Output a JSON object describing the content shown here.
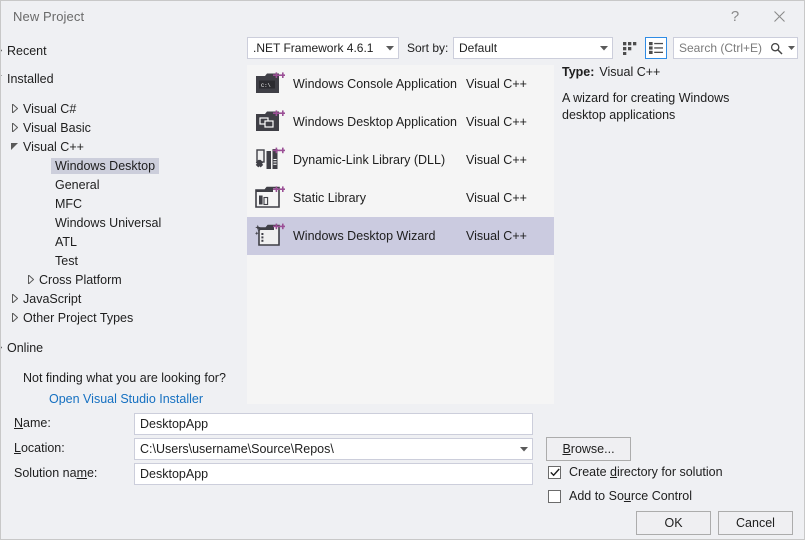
{
  "window": {
    "title": "New Project",
    "help_icon": "question-mark-icon",
    "close_icon": "close-icon"
  },
  "toolbar": {
    "framework_value": ".NET Framework 4.6.1",
    "sort_by_label": "Sort by:",
    "sort_by_value": "Default",
    "view_tiles_icon": "tiles-view-icon",
    "view_list_icon": "list-view-icon",
    "search_placeholder": "Search (Ctrl+E)",
    "search_value": "",
    "search_icon": "magnifier-icon",
    "accent_selected": "#2f8ce5"
  },
  "sidebar": {
    "items": [
      {
        "label": "Recent",
        "level": 0,
        "arrow": "collapsed",
        "selected": false
      },
      {
        "label": "Installed",
        "level": 0,
        "arrow": "expanded",
        "selected": false
      },
      {
        "label": "Visual C#",
        "level": 1,
        "arrow": "collapsed",
        "selected": false
      },
      {
        "label": "Visual Basic",
        "level": 1,
        "arrow": "collapsed",
        "selected": false
      },
      {
        "label": "Visual C++",
        "level": 1,
        "arrow": "expanded",
        "selected": false
      },
      {
        "label": "Windows Desktop",
        "level": 2,
        "arrow": "none",
        "selected": true
      },
      {
        "label": "General",
        "level": 2,
        "arrow": "none",
        "selected": false
      },
      {
        "label": "MFC",
        "level": 2,
        "arrow": "none",
        "selected": false
      },
      {
        "label": "Windows Universal",
        "level": 2,
        "arrow": "none",
        "selected": false
      },
      {
        "label": "ATL",
        "level": 2,
        "arrow": "none",
        "selected": false
      },
      {
        "label": "Test",
        "level": 2,
        "arrow": "none",
        "selected": false
      },
      {
        "label": "Cross Platform",
        "level": 2,
        "arrow": "collapsed",
        "selected": false
      },
      {
        "label": "JavaScript",
        "level": 1,
        "arrow": "collapsed",
        "selected": false
      },
      {
        "label": "Other Project Types",
        "level": 1,
        "arrow": "collapsed",
        "selected": false
      },
      {
        "label": "Online",
        "level": 0,
        "arrow": "collapsed",
        "selected": false
      }
    ],
    "helper_text": "Not finding what you are looking for?",
    "installer_link": "Open Visual Studio Installer",
    "link_color": "#1570c1",
    "selection_color": "#cccedb"
  },
  "templates": {
    "selected_row_color": "#cbcbe0",
    "items": [
      {
        "name": "Windows Console Application",
        "language": "Visual C++",
        "icon": "console-app-icon",
        "selected": false
      },
      {
        "name": "Windows Desktop Application",
        "language": "Visual C++",
        "icon": "desktop-app-icon",
        "selected": false
      },
      {
        "name": "Dynamic-Link Library (DLL)",
        "language": "Visual C++",
        "icon": "dll-icon",
        "selected": false
      },
      {
        "name": "Static Library",
        "language": "Visual C++",
        "icon": "static-lib-icon",
        "selected": false
      },
      {
        "name": "Windows Desktop Wizard",
        "language": "Visual C++",
        "icon": "desktop-wizard-icon",
        "selected": true
      }
    ]
  },
  "details": {
    "type_label": "Type:",
    "type_value": "Visual C++",
    "description": "A wizard for creating Windows desktop applications"
  },
  "form": {
    "name_label_pre": "",
    "name_label_key": "N",
    "name_label_post": "ame:",
    "name_value": "DesktopApp",
    "location_label_key": "L",
    "location_label_post": "ocation:",
    "location_value": "C:\\Users\\username\\Source\\Repos\\",
    "solution_label_pre": "Solution na",
    "solution_label_key": "m",
    "solution_label_post": "e:",
    "solution_value": "DesktopApp",
    "browse_label_pre": "B",
    "browse_label_key": "B",
    "browse_label_post": "rowse...",
    "create_directory_pre": "Create ",
    "create_directory_key": "d",
    "create_directory_post": "irectory for solution",
    "create_directory_checked": true,
    "source_control_pre": "Add to So",
    "source_control_key": "u",
    "source_control_post": "rce Control",
    "source_control_checked": false
  },
  "footer": {
    "ok_label": "OK",
    "cancel_label": "Cancel"
  }
}
